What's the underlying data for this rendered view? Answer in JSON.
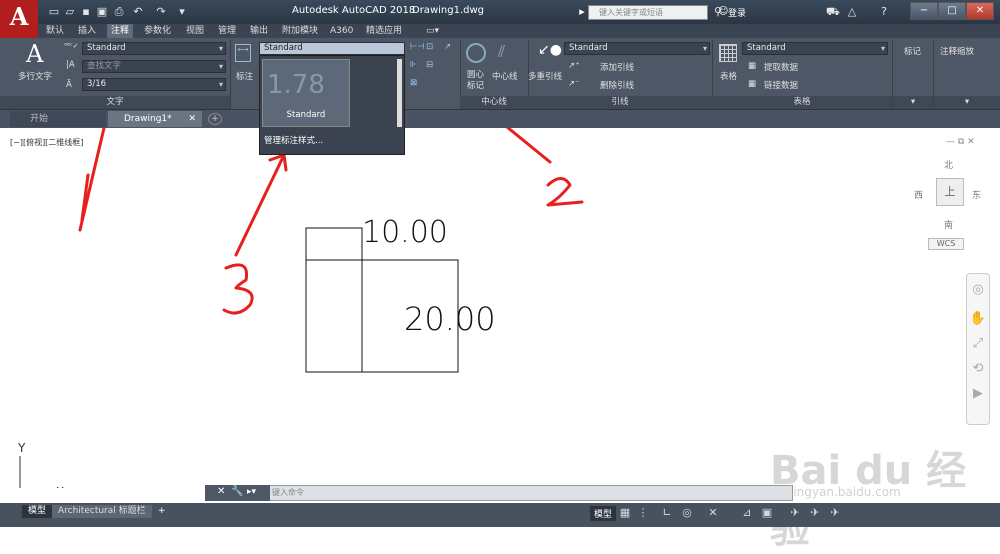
{
  "app": {
    "logo": "A",
    "title": "Autodesk AutoCAD 2018",
    "file": "Drawing1.dwg"
  },
  "search": {
    "placeholder": "键入关键字或短语"
  },
  "login": {
    "label": "登录"
  },
  "window_buttons": {
    "min": "−",
    "max": "□",
    "close": "✕"
  },
  "menu_tabs": [
    "默认",
    "插入",
    "注释",
    "参数化",
    "视图",
    "管理",
    "输出",
    "附加模块",
    "A360",
    "精选应用"
  ],
  "active_tab": "注释",
  "ribbon": {
    "text_panel": {
      "big_button": "多行文字",
      "style": "Standard",
      "find_placeholder": "查找文字",
      "height": "3/16",
      "label": "文字"
    },
    "dim_panel": {
      "big_button": "标注",
      "style": "Standard"
    },
    "center_panel": {
      "center_mark": "圆心标记",
      "center_line": "中心线",
      "label": "中心线"
    },
    "leader_panel": {
      "big_button": "多重引线",
      "style": "Standard",
      "add": "添加引线",
      "remove": "删除引线",
      "label": "引线"
    },
    "table_panel": {
      "big_button": "表格",
      "style": "Standard",
      "extract": "提取数据",
      "link": "链接数据",
      "label": "表格"
    },
    "mark_panel": {
      "label": "标记"
    },
    "scale_panel": {
      "label": "注释缩放"
    }
  },
  "dimstyle_popup": {
    "preview_value": "1.78",
    "preview_label": "Standard",
    "manage": "管理标注样式..."
  },
  "doc_tabs": [
    "开始",
    "Drawing1*"
  ],
  "viewport_label": "[−][俯视][二维线框]",
  "drawing": {
    "dim1": "10.00",
    "dim2": "20.00",
    "axis_y": "Y",
    "axis_x": "X"
  },
  "compass": {
    "n": "北",
    "s": "南",
    "e": "东",
    "w": "西",
    "center": "上",
    "wcs": "WCS"
  },
  "annotations": [
    "1",
    "2",
    "3"
  ],
  "command": {
    "placeholder": "键入命令"
  },
  "layout_tabs": [
    "模型",
    "Architectural 标题栏"
  ],
  "status": {
    "model": "模型"
  },
  "watermark": {
    "main": "Bai du 经验",
    "sub": "jingyan.baidu.com"
  }
}
